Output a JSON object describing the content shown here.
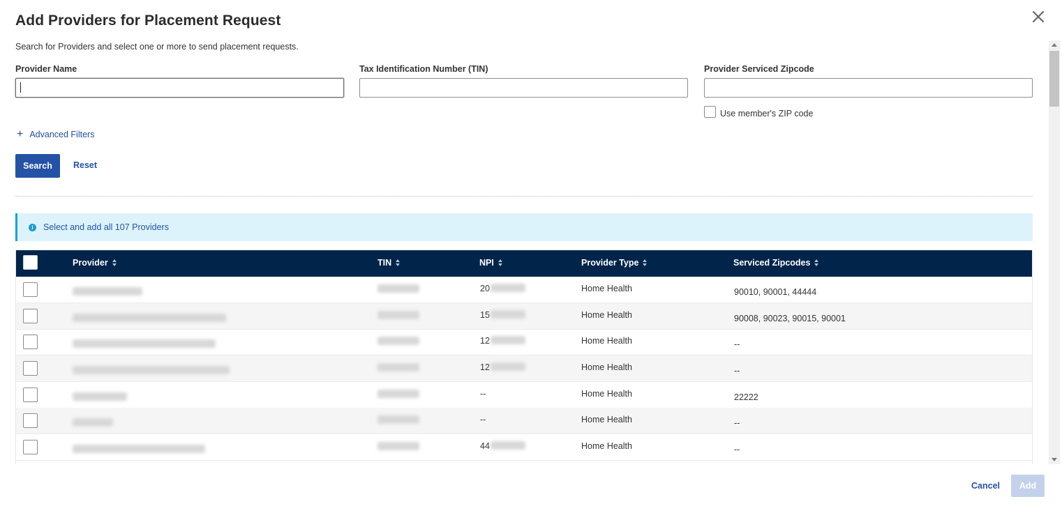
{
  "dialog": {
    "title": "Add Providers for Placement Request",
    "subtitle": "Search for Providers and select one or more to send placement requests."
  },
  "form": {
    "provider_name_label": "Provider Name",
    "provider_name_value": "",
    "tin_label": "Tax Identification Number (TIN)",
    "tin_value": "",
    "zip_label": "Provider Serviced Zipcode",
    "zip_value": "",
    "use_member_zip_label": "Use member's ZIP code",
    "use_member_zip_checked": false,
    "advanced_filters_label": "Advanced Filters",
    "search_label": "Search",
    "reset_label": "Reset"
  },
  "banner": {
    "text": "Select and add all 107 Providers",
    "icon": "info-icon"
  },
  "table": {
    "columns": [
      "Provider",
      "TIN",
      "NPI",
      "Provider Type",
      "Serviced Zipcodes"
    ],
    "rows": [
      {
        "npi_prefix": "20",
        "type": "Home Health",
        "zipcodes": "90010, 90001, 44444"
      },
      {
        "npi_prefix": "15",
        "type": "Home Health",
        "zipcodes": "90008, 90023, 90015, 90001"
      },
      {
        "npi_prefix": "12",
        "type": "Home Health",
        "zipcodes": "--"
      },
      {
        "npi_prefix": "12",
        "type": "Home Health",
        "zipcodes": "--"
      },
      {
        "npi_prefix": "--",
        "type": "Home Health",
        "zipcodes": "22222"
      },
      {
        "npi_prefix": "--",
        "type": "Home Health",
        "zipcodes": "--"
      },
      {
        "npi_prefix": "44",
        "type": "Home Health",
        "zipcodes": "--"
      }
    ]
  },
  "footer": {
    "cancel_label": "Cancel",
    "add_label": "Add"
  },
  "colors": {
    "primary": "#2452a6",
    "table_header": "#00244a",
    "banner_bg": "#ddf3fb",
    "banner_accent": "#13a3d6",
    "add_disabled": "#c4d1ea"
  }
}
